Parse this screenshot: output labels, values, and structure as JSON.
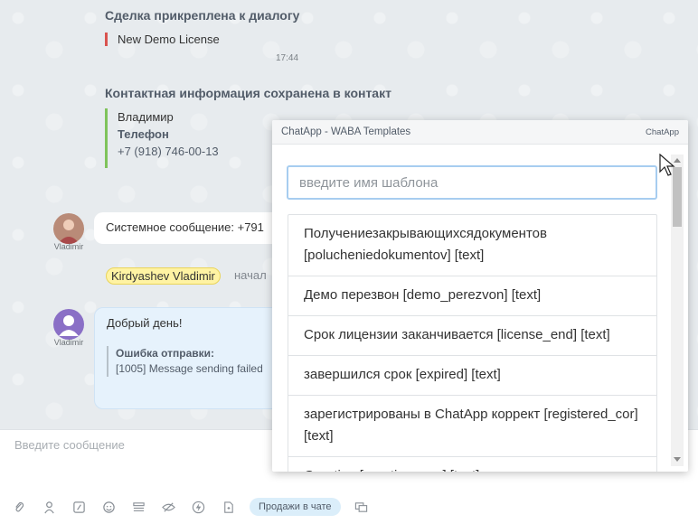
{
  "chat": {
    "deal_title": "Сделка прикреплена к диалогу",
    "deal_name": "New Demo License",
    "deal_time": "17:44",
    "contact_title": "Контактная информация сохранена в контакт",
    "contact_name": "Владимир",
    "contact_phone_label": "Телефон",
    "contact_phone": "+7 (918) 746-00-13",
    "system_msg_author": "Vladimir",
    "system_msg_text": "Системное сообщение: +791",
    "user_tag": "Kirdyashev Vladimir",
    "user_tag_after": "начал",
    "greeting_author": "Vladimir",
    "greeting_text": "Добрый день!",
    "error_title": "Ошибка отправки:",
    "error_text": "[1005] Message sending failed"
  },
  "input": {
    "placeholder": "Введите сообщение",
    "sales_button": "Продажи в чате"
  },
  "toolbar_icons": [
    "paperclip-icon",
    "person-icon",
    "edit-icon",
    "smile-icon",
    "list-icon",
    "eye-off-icon",
    "lightning-icon",
    "document-icon",
    "chat-window-icon"
  ],
  "popup": {
    "title": "ChatApp - WABA Templates",
    "brand": "ChatApp",
    "search_placeholder": "введите имя шаблона",
    "templates": [
      "Получениезакрывающихсядокументов [polucheniedokumentov] [text]",
      "Демо перезвон [demo_perezvon] [text]",
      "Срок лицензии заканчивается [license_end] [text]",
      "завершился срок [expired] [text]",
      "зарегистрированы в ChatApp коррект [registered_cor] [text]",
      "Greeting [greeting_eng] [text]"
    ]
  },
  "colors": {
    "deal_accent": "#d9534f",
    "contact_accent": "#7fc35b",
    "highlight": "#fff3a3",
    "bubble_blue": "#e6f2fc"
  }
}
